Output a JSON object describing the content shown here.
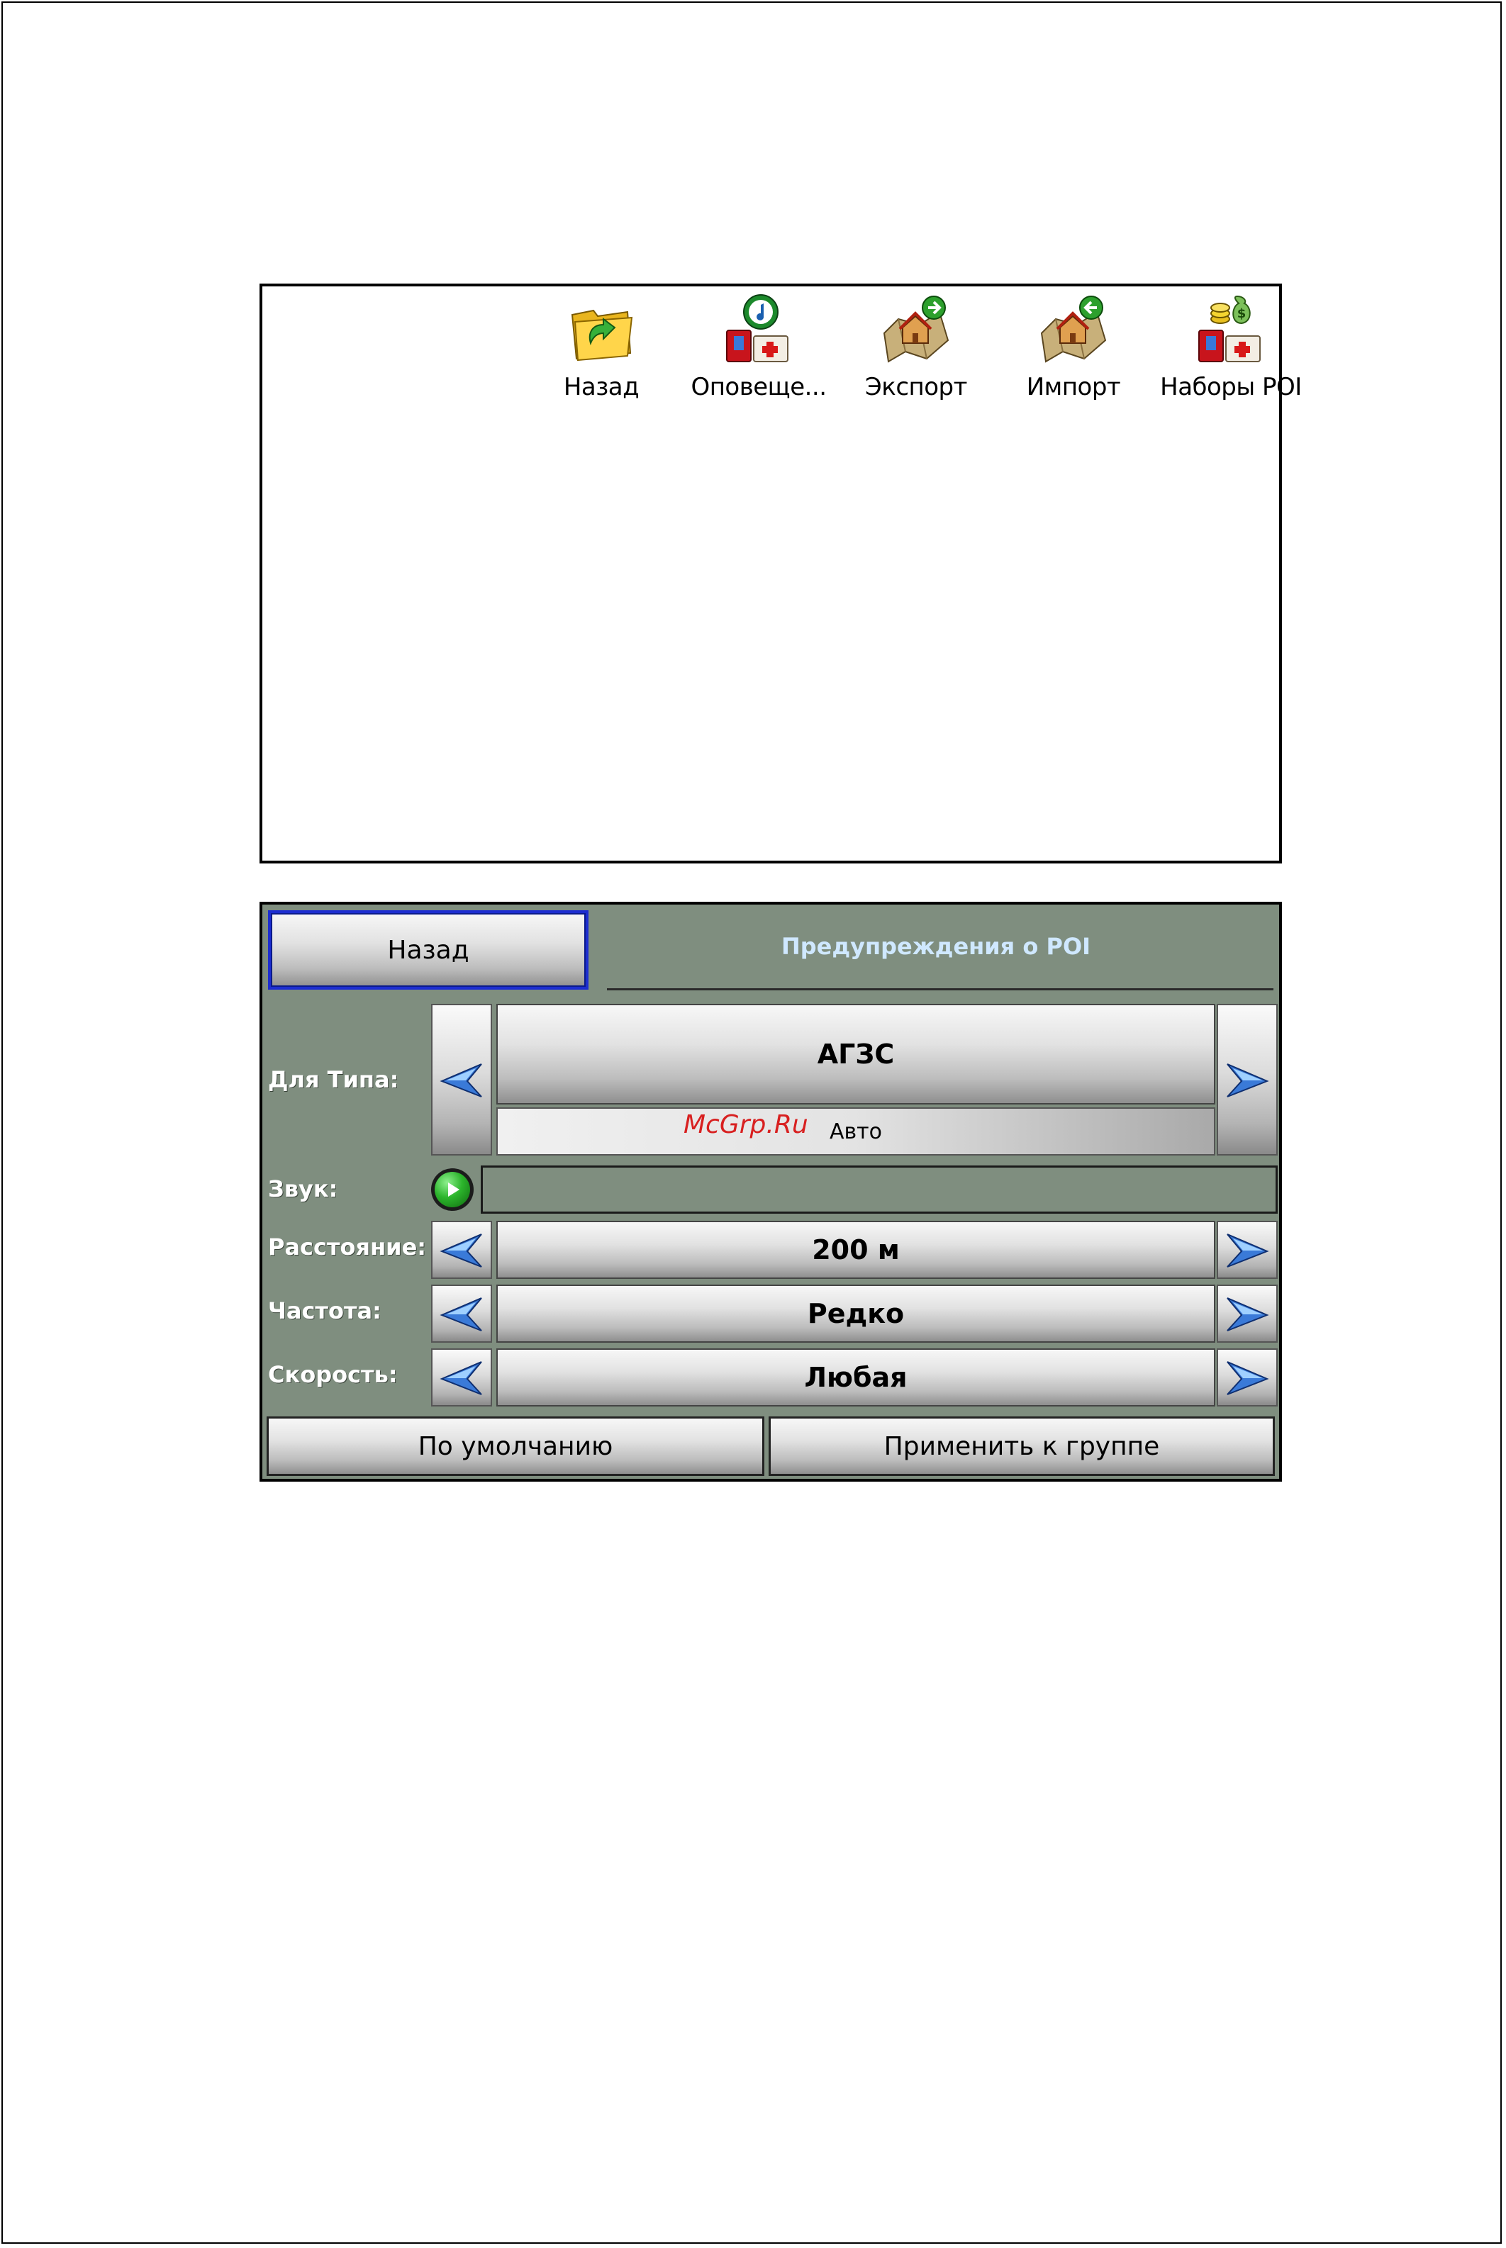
{
  "menu": {
    "items": [
      {
        "label": "Назад",
        "icon": "folder-back-icon"
      },
      {
        "label": "Оповеще...",
        "icon": "poi-alert-icon"
      },
      {
        "label": "Экспорт",
        "icon": "map-export-icon"
      },
      {
        "label": "Импорт",
        "icon": "map-import-icon"
      },
      {
        "label": "Наборы POI",
        "icon": "poi-sets-icon"
      }
    ]
  },
  "poi": {
    "back_label": "Назад",
    "title": "Предупреждения о POI",
    "type_label": "Для Типа:",
    "type_value": "АГЗС",
    "type_category": "Авто",
    "sound_label": "Звук:",
    "distance_label": "Расстояние:",
    "distance_value": "200 м",
    "frequency_label": "Частота:",
    "frequency_value": "Редко",
    "speed_label": "Скорость:",
    "speed_value": "Любая",
    "default_button": "По умолчанию",
    "apply_group_button": "Применить к группе"
  },
  "watermark": "McGrp.Ru",
  "colors": {
    "panel_bg": "#7f8e7f",
    "title_text": "#cfe8ff",
    "selected_border": "#1c2dd0",
    "watermark": "#d82020"
  }
}
